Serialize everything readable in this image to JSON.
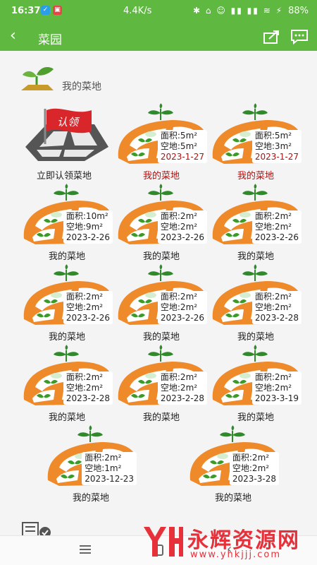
{
  "status_bar": {
    "time": "16:37",
    "network_speed": "4.4K/s",
    "battery": "88%"
  },
  "title_bar": {
    "back_icon": "chevron-left-icon",
    "title": "菜园",
    "share_icon": "share-icon",
    "chat_icon": "chat-bubble-icon"
  },
  "header": {
    "icon": "sprout-logo-icon",
    "label": "我的菜地"
  },
  "claim_card": {
    "flag_text": "认领",
    "label": "立即认领菜地"
  },
  "plots": [
    {
      "area": "面积:5m²",
      "vacant": "空地:5m²",
      "date": "2023-1-27",
      "name": "我的菜地",
      "highlight": true
    },
    {
      "area": "面积:5m²",
      "vacant": "空地:3m²",
      "date": "2023-1-27",
      "name": "我的菜地",
      "highlight": true
    },
    {
      "area": "面积:10m²",
      "vacant": "空地:9m²",
      "date": "2023-2-26",
      "name": "我的菜地",
      "highlight": false
    },
    {
      "area": "面积:2m²",
      "vacant": "空地:2m²",
      "date": "2023-2-26",
      "name": "我的菜地",
      "highlight": false
    },
    {
      "area": "面积:2m²",
      "vacant": "空地:2m²",
      "date": "2023-2-26",
      "name": "我的菜地",
      "highlight": false
    },
    {
      "area": "面积:2m²",
      "vacant": "空地:2m²",
      "date": "2023-2-26",
      "name": "我的菜地",
      "highlight": false
    },
    {
      "area": "面积:2m²",
      "vacant": "空地:2m²",
      "date": "2023-2-26",
      "name": "我的菜地",
      "highlight": false
    },
    {
      "area": "面积:2m²",
      "vacant": "空地:2m²",
      "date": "2023-2-28",
      "name": "我的菜地",
      "highlight": false
    },
    {
      "area": "面积:2m²",
      "vacant": "空地:2m²",
      "date": "2023-2-28",
      "name": "我的菜地",
      "highlight": false
    },
    {
      "area": "面积:2m²",
      "vacant": "空地:2m²",
      "date": "2023-2-28",
      "name": "我的菜地",
      "highlight": false
    },
    {
      "area": "面积:2m²",
      "vacant": "空地:2m²",
      "date": "2023-3-19",
      "name": "我的菜地",
      "highlight": false
    },
    {
      "area": "面积:2m²",
      "vacant": "空地:1m²",
      "date": "2023-12-23",
      "name": "我的菜地",
      "highlight": false
    },
    {
      "area": "面积:2m²",
      "vacant": "空地:2m²",
      "date": "2023-3-28",
      "name": "我的菜地",
      "highlight": false
    }
  ],
  "nav_bar": {
    "menu_icon": "menu-icon",
    "home_icon": "home-square-icon",
    "back_icon": "back-arrow-icon"
  },
  "watermark": {
    "logo_text": "YH",
    "text": "永辉资源网",
    "url": "www.yhkjjj.com"
  },
  "colors": {
    "accent": "#5fb840",
    "plot_orange": "#ef8a2a",
    "date_red": "#b01010",
    "watermark_red": "#e6303a"
  }
}
